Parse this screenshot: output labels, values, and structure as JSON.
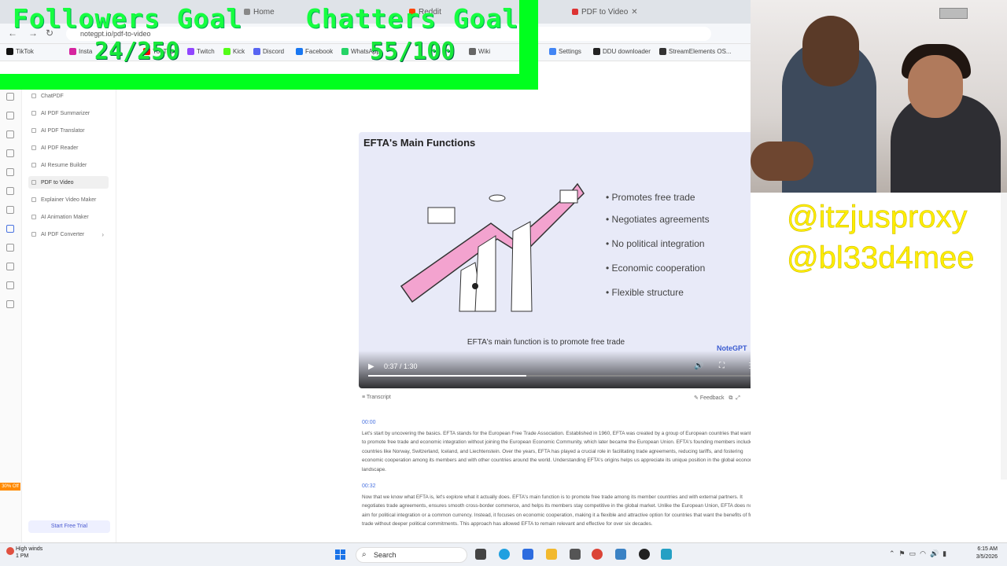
{
  "browser": {
    "tabs": [
      {
        "label": "Home",
        "icon": "home-icon"
      },
      {
        "label": "Reddit",
        "icon": "reddit-icon"
      },
      {
        "label": "PDF to Video",
        "icon": "pdf-icon"
      }
    ],
    "url": "notegpt.io/pdf-to-video",
    "bookmarks": [
      {
        "label": "TikTok",
        "color": "#111111"
      },
      {
        "label": "Insta",
        "color": "#d6249f"
      },
      {
        "label": "YouTube",
        "color": "#ff0000"
      },
      {
        "label": "Twitch",
        "color": "#9146ff"
      },
      {
        "label": "Kick",
        "color": "#53fc18"
      },
      {
        "label": "Discord",
        "color": "#5865f2"
      },
      {
        "label": "Facebook",
        "color": "#1877f2"
      },
      {
        "label": "WhatsApp",
        "color": "#25d366"
      },
      {
        "label": "Wiki",
        "color": "#666666"
      },
      {
        "label": "Settings",
        "color": "#4285f4"
      },
      {
        "label": "DDU downloader",
        "color": "#222222"
      },
      {
        "label": "StreamElements OS...",
        "color": "#333333"
      }
    ]
  },
  "overlay": {
    "followers_label": "Followers Goal",
    "followers_count": "24/250",
    "chatters_label": "Chatters Goal",
    "chatters_count": "55/100",
    "bar_color": "#00ff1e"
  },
  "sidebar": {
    "items": [
      {
        "label": "ChatPDF",
        "active": false
      },
      {
        "label": "AI PDF Summarizer",
        "active": false
      },
      {
        "label": "AI PDF Translator",
        "active": false
      },
      {
        "label": "AI PDF Reader",
        "active": false
      },
      {
        "label": "AI Resume Builder",
        "active": false
      },
      {
        "label": "PDF to Video",
        "active": true
      },
      {
        "label": "Explainer Video Maker",
        "active": false
      },
      {
        "label": "AI Animation Maker",
        "active": false
      },
      {
        "label": "AI PDF Converter",
        "active": false,
        "chevron": "›"
      }
    ],
    "promo": "30% Off",
    "trial_button": "Start Free Trial"
  },
  "video": {
    "slide_title": "EFTA's Main Functions",
    "bullets": [
      "• Promotes free trade",
      "• Negotiates agreements",
      "• No political integration",
      "• Economic cooperation",
      "• Flexible structure"
    ],
    "caption": "EFTA's main function is to promote free trade",
    "brand": "NoteGPT",
    "time": "0:37 / 1:30",
    "progress": 0.411
  },
  "transcript": {
    "label": "Transcript",
    "feedback": "Feedback",
    "segments": [
      {
        "time": "00:00",
        "text": "Let's start by uncovering the basics. EFTA stands for the European Free Trade Association. Established in 1960, EFTA was created by a group of European countries that wanted to promote free trade and economic integration without joining the European Economic Community, which later became the European Union. EFTA's founding members included countries like Norway, Switzerland, Iceland, and Liechtenstein. Over the years, EFTA has played a crucial role in facilitating trade agreements, reducing tariffs, and fostering economic cooperation among its members and with other countries around the world. Understanding EFTA's origins helps us appreciate its unique position in the global economic landscape."
      },
      {
        "time": "00:32",
        "text": "Now that we know what EFTA is, let's explore what it actually does. EFTA's main function is to promote free trade among its member countries and with external partners. It negotiates trade agreements, ensures smooth cross-border commerce, and helps its members stay competitive in the global market. Unlike the European Union, EFTA does not aim for political integration or a common currency. Instead, it focuses on economic cooperation, making it a flexible and attractive option for countries that want the benefits of free trade without deeper political commitments. This approach has allowed EFTA to remain relevant and effective for over six decades."
      }
    ]
  },
  "stream": {
    "handles": [
      "@itzjusproxy",
      "@bl33d4mee"
    ],
    "handle_color": "#ffee00"
  },
  "taskbar": {
    "weather_title": "High winds",
    "weather_sub": "1 PM",
    "search_placeholder": "Search",
    "clock_time": "6:15 AM",
    "clock_date": "3/5/2026"
  }
}
